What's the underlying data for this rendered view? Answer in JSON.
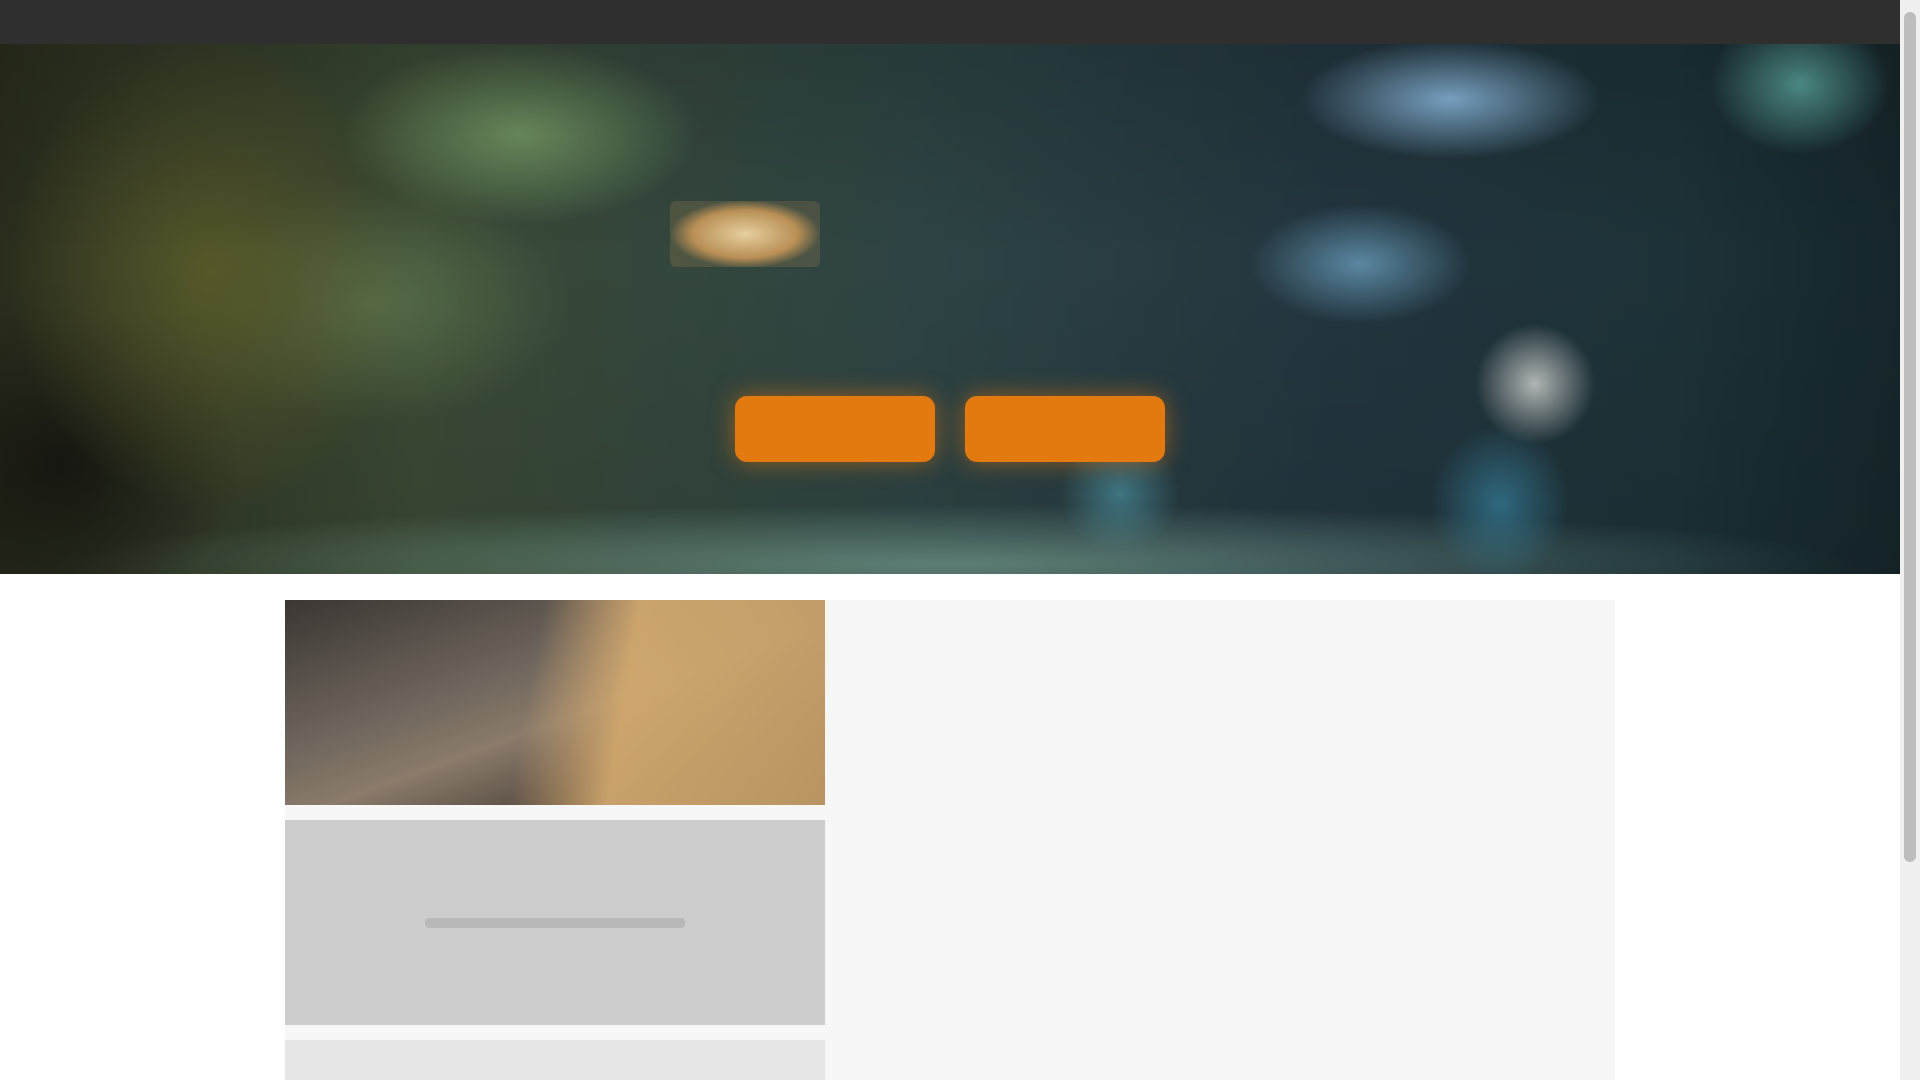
{
  "nav": {
    "links": [
      "",
      "",
      "",
      ""
    ]
  },
  "hero": {
    "logo_icon": "game-logo-icon",
    "title": "",
    "subtitle": "",
    "primary_button": "",
    "secondary_button": ""
  },
  "cards": [
    {
      "title": "",
      "text": "",
      "link": ""
    },
    {
      "title": "",
      "text": "",
      "link": ""
    },
    {
      "title": "",
      "text": "",
      "link": ""
    }
  ],
  "colors": {
    "topbar": "#2f2f2f",
    "accent_button": "#e37a10",
    "link": "#5aa0d8",
    "card_background": "#f7f7f7"
  }
}
